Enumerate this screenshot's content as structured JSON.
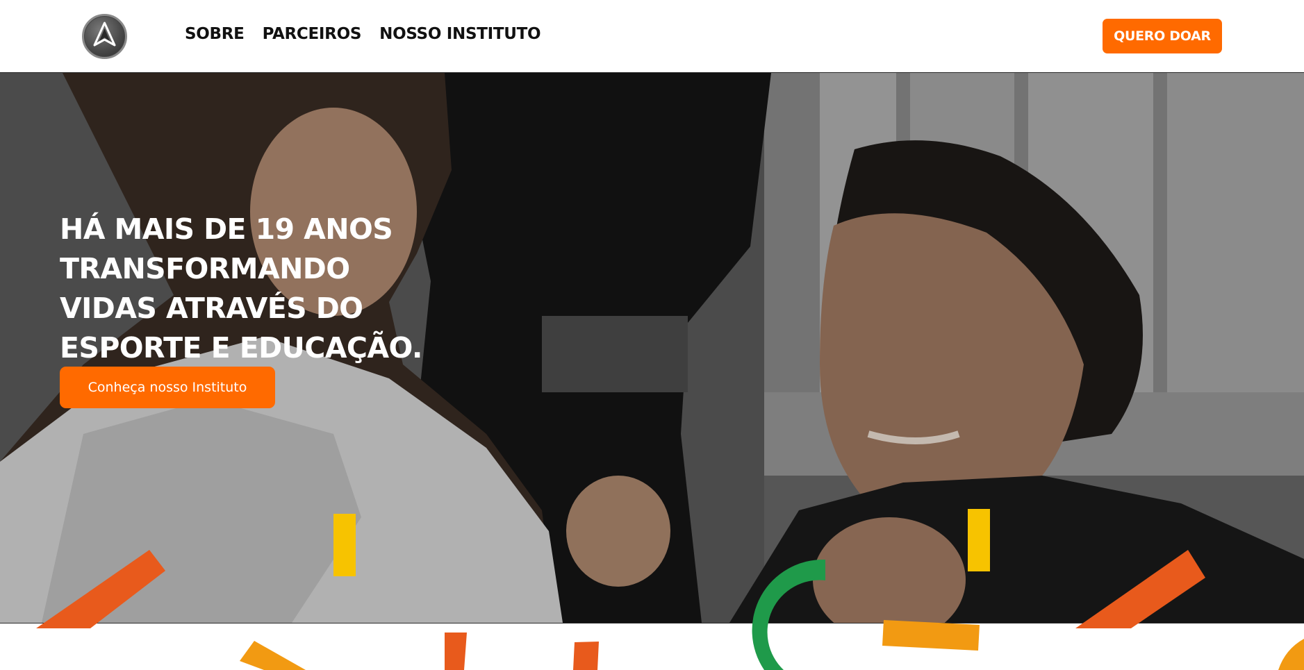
{
  "header": {
    "logo_icon": "jiu-jitsu-triangle-logo",
    "nav": [
      {
        "label": "SOBRE"
      },
      {
        "label": "PARCEIROS"
      },
      {
        "label": "NOSSO INSTITUTO"
      }
    ],
    "donate_label": "QUERO DOAR"
  },
  "hero": {
    "title": "HÁ MAIS DE 19 ANOS\nTRANSFORMANDO\nVIDAS ATRAVÉS DO\nESPORTE E EDUCAÇÃO.",
    "cta_label": "Conheça nosso Instituto"
  },
  "colors": {
    "accent": "#ff6a00",
    "confetti_yellow": "#f7c300",
    "confetti_orange": "#e85a1c",
    "confetti_amber": "#f29a12",
    "confetti_green": "#1f9a4a"
  }
}
